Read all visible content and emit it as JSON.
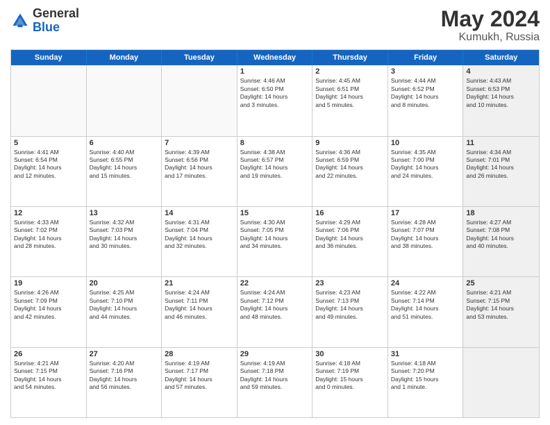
{
  "header": {
    "logo": {
      "general": "General",
      "blue": "Blue"
    },
    "title": "May 2024",
    "location": "Kumukh, Russia"
  },
  "weekdays": [
    "Sunday",
    "Monday",
    "Tuesday",
    "Wednesday",
    "Thursday",
    "Friday",
    "Saturday"
  ],
  "rows": [
    [
      {
        "day": "",
        "empty": true
      },
      {
        "day": "",
        "empty": true
      },
      {
        "day": "",
        "empty": true
      },
      {
        "day": "1",
        "info": "Sunrise: 4:46 AM\nSunset: 6:50 PM\nDaylight: 14 hours\nand 3 minutes."
      },
      {
        "day": "2",
        "info": "Sunrise: 4:45 AM\nSunset: 6:51 PM\nDaylight: 14 hours\nand 5 minutes."
      },
      {
        "day": "3",
        "info": "Sunrise: 4:44 AM\nSunset: 6:52 PM\nDaylight: 14 hours\nand 8 minutes."
      },
      {
        "day": "4",
        "info": "Sunrise: 4:43 AM\nSunset: 6:53 PM\nDaylight: 14 hours\nand 10 minutes.",
        "shaded": true
      }
    ],
    [
      {
        "day": "5",
        "info": "Sunrise: 4:41 AM\nSunset: 6:54 PM\nDaylight: 14 hours\nand 12 minutes."
      },
      {
        "day": "6",
        "info": "Sunrise: 4:40 AM\nSunset: 6:55 PM\nDaylight: 14 hours\nand 15 minutes."
      },
      {
        "day": "7",
        "info": "Sunrise: 4:39 AM\nSunset: 6:56 PM\nDaylight: 14 hours\nand 17 minutes."
      },
      {
        "day": "8",
        "info": "Sunrise: 4:38 AM\nSunset: 6:57 PM\nDaylight: 14 hours\nand 19 minutes."
      },
      {
        "day": "9",
        "info": "Sunrise: 4:36 AM\nSunset: 6:59 PM\nDaylight: 14 hours\nand 22 minutes."
      },
      {
        "day": "10",
        "info": "Sunrise: 4:35 AM\nSunset: 7:00 PM\nDaylight: 14 hours\nand 24 minutes."
      },
      {
        "day": "11",
        "info": "Sunrise: 4:34 AM\nSunset: 7:01 PM\nDaylight: 14 hours\nand 26 minutes.",
        "shaded": true
      }
    ],
    [
      {
        "day": "12",
        "info": "Sunrise: 4:33 AM\nSunset: 7:02 PM\nDaylight: 14 hours\nand 28 minutes."
      },
      {
        "day": "13",
        "info": "Sunrise: 4:32 AM\nSunset: 7:03 PM\nDaylight: 14 hours\nand 30 minutes."
      },
      {
        "day": "14",
        "info": "Sunrise: 4:31 AM\nSunset: 7:04 PM\nDaylight: 14 hours\nand 32 minutes."
      },
      {
        "day": "15",
        "info": "Sunrise: 4:30 AM\nSunset: 7:05 PM\nDaylight: 14 hours\nand 34 minutes."
      },
      {
        "day": "16",
        "info": "Sunrise: 4:29 AM\nSunset: 7:06 PM\nDaylight: 14 hours\nand 36 minutes."
      },
      {
        "day": "17",
        "info": "Sunrise: 4:28 AM\nSunset: 7:07 PM\nDaylight: 14 hours\nand 38 minutes."
      },
      {
        "day": "18",
        "info": "Sunrise: 4:27 AM\nSunset: 7:08 PM\nDaylight: 14 hours\nand 40 minutes.",
        "shaded": true
      }
    ],
    [
      {
        "day": "19",
        "info": "Sunrise: 4:26 AM\nSunset: 7:09 PM\nDaylight: 14 hours\nand 42 minutes."
      },
      {
        "day": "20",
        "info": "Sunrise: 4:25 AM\nSunset: 7:10 PM\nDaylight: 14 hours\nand 44 minutes."
      },
      {
        "day": "21",
        "info": "Sunrise: 4:24 AM\nSunset: 7:11 PM\nDaylight: 14 hours\nand 46 minutes."
      },
      {
        "day": "22",
        "info": "Sunrise: 4:24 AM\nSunset: 7:12 PM\nDaylight: 14 hours\nand 48 minutes."
      },
      {
        "day": "23",
        "info": "Sunrise: 4:23 AM\nSunset: 7:13 PM\nDaylight: 14 hours\nand 49 minutes."
      },
      {
        "day": "24",
        "info": "Sunrise: 4:22 AM\nSunset: 7:14 PM\nDaylight: 14 hours\nand 51 minutes."
      },
      {
        "day": "25",
        "info": "Sunrise: 4:21 AM\nSunset: 7:15 PM\nDaylight: 14 hours\nand 53 minutes.",
        "shaded": true
      }
    ],
    [
      {
        "day": "26",
        "info": "Sunrise: 4:21 AM\nSunset: 7:15 PM\nDaylight: 14 hours\nand 54 minutes."
      },
      {
        "day": "27",
        "info": "Sunrise: 4:20 AM\nSunset: 7:16 PM\nDaylight: 14 hours\nand 56 minutes."
      },
      {
        "day": "28",
        "info": "Sunrise: 4:19 AM\nSunset: 7:17 PM\nDaylight: 14 hours\nand 57 minutes."
      },
      {
        "day": "29",
        "info": "Sunrise: 4:19 AM\nSunset: 7:18 PM\nDaylight: 14 hours\nand 59 minutes."
      },
      {
        "day": "30",
        "info": "Sunrise: 4:18 AM\nSunset: 7:19 PM\nDaylight: 15 hours\nand 0 minutes."
      },
      {
        "day": "31",
        "info": "Sunrise: 4:18 AM\nSunset: 7:20 PM\nDaylight: 15 hours\nand 1 minute."
      },
      {
        "day": "",
        "empty": true,
        "shaded": true
      }
    ]
  ]
}
